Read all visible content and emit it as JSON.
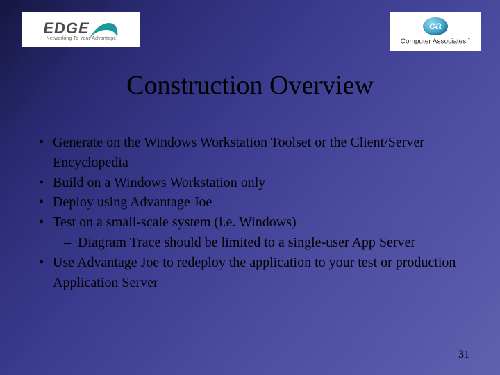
{
  "logos": {
    "left": {
      "main": "EDGE",
      "tagline": "Networking To Your Advantage"
    },
    "right": {
      "mark": "ca",
      "label": "Computer Associates",
      "tm": "™"
    }
  },
  "title": "Construction Overview",
  "bullets": [
    {
      "text": "Generate on the Windows Workstation Toolset or the Client/Server Encyclopedia"
    },
    {
      "text": "Build on a Windows Workstation only"
    },
    {
      "text": "Deploy using Advantage Joe"
    },
    {
      "text": "Test on a small-scale system (i.e. Windows)",
      "sub": [
        "Diagram Trace should be limited to a single-user App Server"
      ]
    },
    {
      "text": "Use Advantage Joe to redeploy the application to your test or production Application Server"
    }
  ],
  "page_number": "31"
}
